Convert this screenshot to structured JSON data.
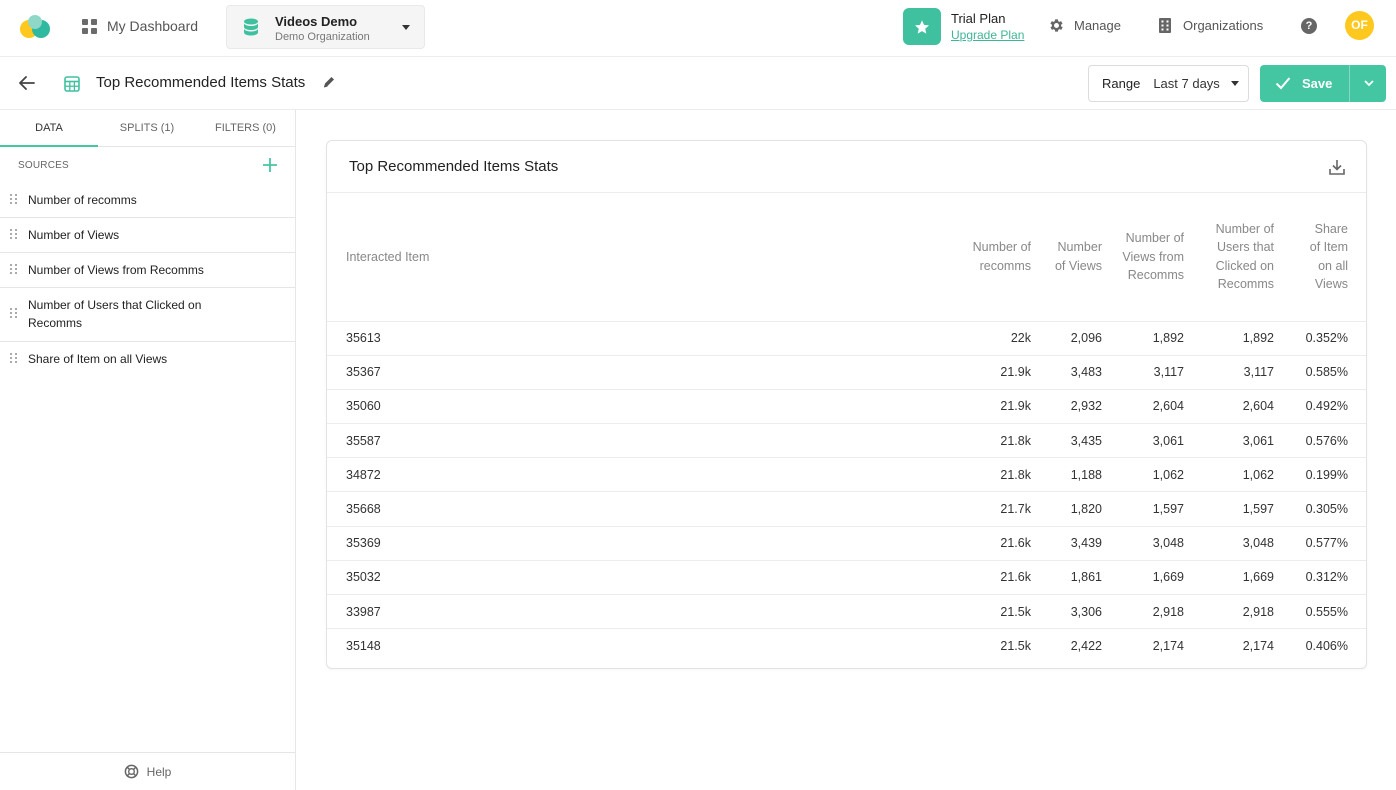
{
  "topbar": {
    "dashboard_label": "My Dashboard",
    "project_title": "Videos Demo",
    "project_org": "Demo Organization",
    "plan_title": "Trial Plan",
    "plan_link": "Upgrade Plan",
    "manage_label": "Manage",
    "organizations_label": "Organizations",
    "help_glyph": "?",
    "avatar_initials": "OF"
  },
  "subbar": {
    "report_title": "Top Recommended Items Stats",
    "range_label": "Range",
    "range_value": "Last 7 days",
    "save_label": "Save"
  },
  "sidebar": {
    "tabs": [
      "DATA",
      "SPLITS (1)",
      "FILTERS (0)"
    ],
    "active_tab": 0,
    "sources_header": "SOURCES",
    "sources": [
      "Number of recomms",
      "Number of Views",
      "Number of Views from Recomms",
      "Number of Users that Clicked on Recomms",
      "Share of Item on all Views"
    ],
    "help_label": "Help"
  },
  "table": {
    "title": "Top Recommended Items Stats",
    "columns": [
      "Interacted Item",
      "Number of recomms",
      "Number of Views",
      "Number of Views from Recomms",
      "Number of Users that Clicked on Recomms",
      "Share of Item on all Views"
    ],
    "rows": [
      [
        "35613",
        "22k",
        "2,096",
        "1,892",
        "1,892",
        "0.352%"
      ],
      [
        "35367",
        "21.9k",
        "3,483",
        "3,117",
        "3,117",
        "0.585%"
      ],
      [
        "35060",
        "21.9k",
        "2,932",
        "2,604",
        "2,604",
        "0.492%"
      ],
      [
        "35587",
        "21.8k",
        "3,435",
        "3,061",
        "3,061",
        "0.576%"
      ],
      [
        "34872",
        "21.8k",
        "1,188",
        "1,062",
        "1,062",
        "0.199%"
      ],
      [
        "35668",
        "21.7k",
        "1,820",
        "1,597",
        "1,597",
        "0.305%"
      ],
      [
        "35369",
        "21.6k",
        "3,439",
        "3,048",
        "3,048",
        "0.577%"
      ],
      [
        "35032",
        "21.6k",
        "1,861",
        "1,669",
        "1,669",
        "0.312%"
      ],
      [
        "33987",
        "21.5k",
        "3,306",
        "2,918",
        "2,918",
        "0.555%"
      ],
      [
        "35148",
        "21.5k",
        "2,422",
        "2,174",
        "2,174",
        "0.406%"
      ]
    ]
  },
  "colors": {
    "accent": "#45c6a3",
    "avatar": "#ffc81e",
    "logo_yellow": "#ffc81e",
    "logo_teal": "#2fb9a0"
  }
}
